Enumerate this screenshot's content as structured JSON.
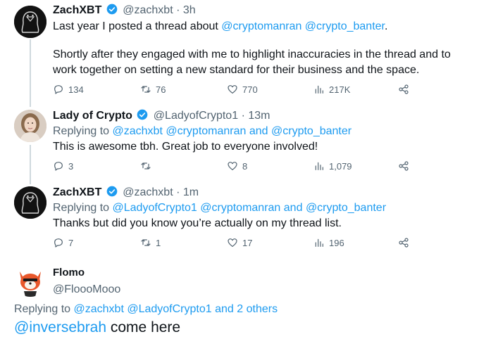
{
  "tweets": [
    {
      "name": "ZachXBT",
      "handle": "@zachxbt",
      "time": "· 3h",
      "text_prefix": "Last year I posted a thread about ",
      "mention1": "@cryptomanran",
      "mention2": "@crypto_banter",
      "text_suffix": ".",
      "line2": "Shortly after they engaged with me to highlight inaccuracies in the thread and to",
      "line3": "work together on setting a new standard for their business and the space.",
      "stats": {
        "replies": "134",
        "retweets": "76",
        "likes": "770",
        "views": "217K"
      }
    },
    {
      "name": "Lady of Crypto",
      "handle": "@LadyofCrypto1",
      "time": "· 13m",
      "replying_label": "Replying to",
      "reply_m1": "@zachxbt",
      "reply_m2": "@cryptomanran",
      "and": "and",
      "reply_m3": "@crypto_banter",
      "text": "This is awesome tbh. Great job to everyone involved!",
      "stats": {
        "replies": "3",
        "retweets": "",
        "likes": "8",
        "views": "1,079"
      }
    },
    {
      "name": "ZachXBT",
      "handle": "@zachxbt",
      "time": "· 1m",
      "replying_label": "Replying to",
      "reply_m1": "@LadyofCrypto1",
      "reply_m2": "@cryptomanran",
      "and": "and",
      "reply_m3": "@crypto_banter",
      "text": "Thanks but did you know you’re actually on my thread list.",
      "stats": {
        "replies": "7",
        "retweets": "1",
        "likes": "17",
        "views": "196"
      }
    }
  ],
  "focused": {
    "name": "Flomo",
    "handle": "@FloooMooo",
    "replying_label": "Replying to",
    "reply_m1": "@zachxbt",
    "reply_m2": "@LadyofCrypto1",
    "and_others": "and 2 others",
    "mention": "@inversebrah",
    "text": " come here"
  },
  "colors": {
    "accent": "#1d9bf0",
    "muted": "#536471",
    "text": "#0f1419",
    "line": "#cfd9de"
  }
}
